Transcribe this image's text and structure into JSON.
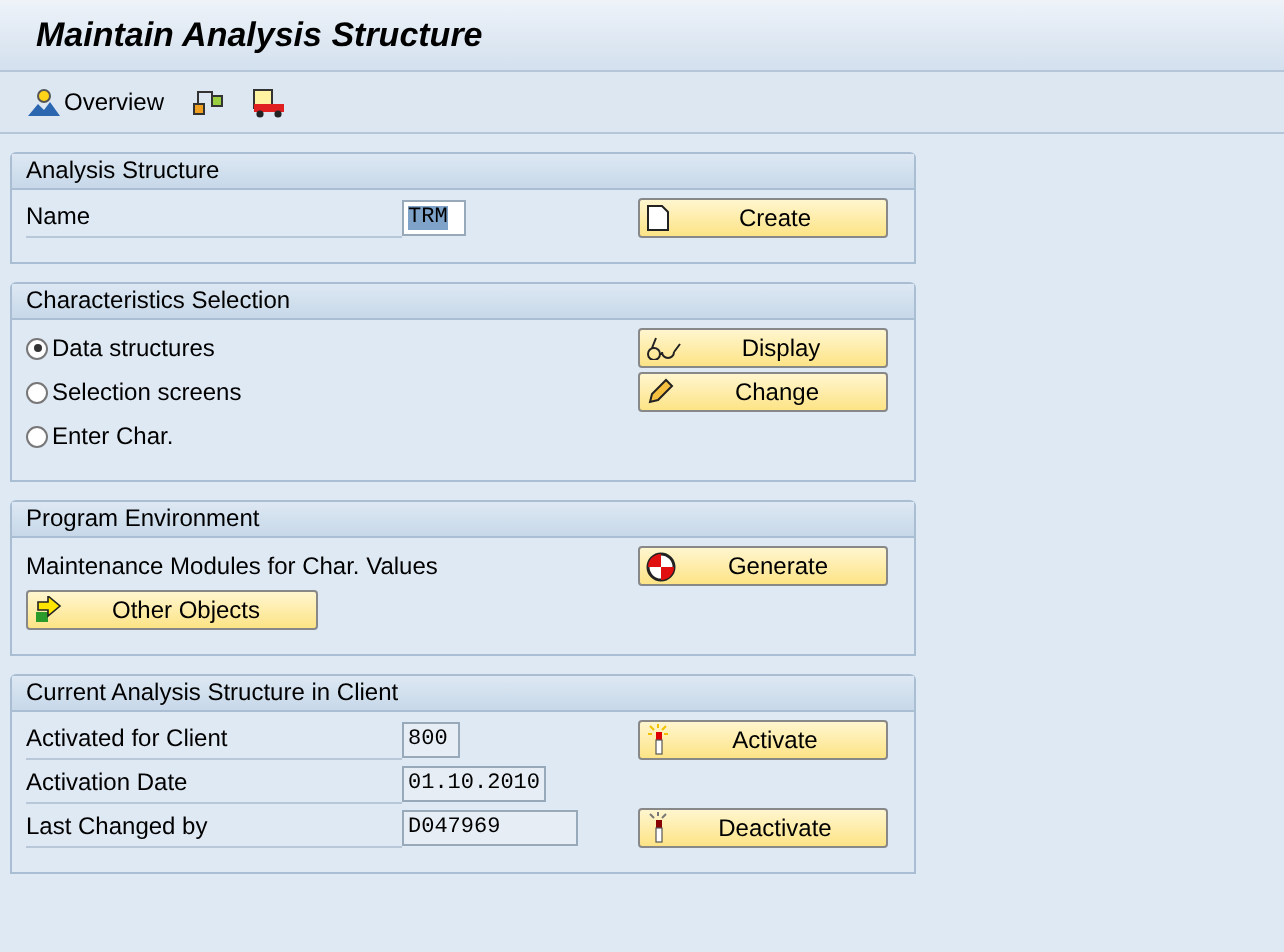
{
  "title": "Maintain Analysis Structure",
  "toolbar": {
    "overview_label": "Overview"
  },
  "groups": [
    {
      "title": "Analysis Structure",
      "rows": [
        {
          "kind": "field",
          "label": "Name",
          "value": "TRM",
          "editable": true,
          "text_selected": true,
          "button": {
            "label": "Create"
          }
        }
      ]
    },
    {
      "title": "Characteristics Selection",
      "rows": [
        {
          "kind": "radio",
          "label": "Data structures",
          "selected": true,
          "button": {
            "label": "Display"
          }
        },
        {
          "kind": "radio",
          "label": "Selection screens",
          "selected": false,
          "button": {
            "label": "Change"
          }
        },
        {
          "kind": "radio",
          "label": "Enter Char.",
          "selected": false
        }
      ]
    },
    {
      "title": "Program Environment",
      "rows": [
        {
          "kind": "text",
          "label": "Maintenance Modules for Char. Values",
          "button": {
            "label": "Generate"
          }
        },
        {
          "kind": "wide-button",
          "label": "Other Objects"
        }
      ]
    },
    {
      "title": "Current Analysis Structure in Client",
      "rows": [
        {
          "kind": "field",
          "label": "Activated for Client",
          "value": "800",
          "editable": false,
          "text_selected": false,
          "button": {
            "label": "Activate"
          }
        },
        {
          "kind": "field",
          "label": "Activation Date",
          "value": "01.10.2010",
          "editable": false,
          "text_selected": false
        },
        {
          "kind": "field",
          "label": "Last Changed by",
          "value": "D047969",
          "editable": false,
          "text_selected": false,
          "button": {
            "label": "Deactivate"
          }
        }
      ]
    }
  ]
}
